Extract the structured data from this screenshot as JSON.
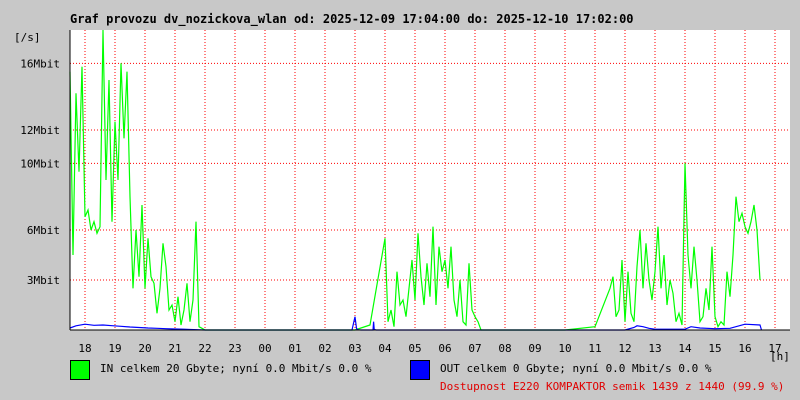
{
  "title": "Graf provozu dv_nozickova_wlan od: 2025-12-09 17:04:00 do: 2025-12-10 17:02:00",
  "colors": {
    "in": "#00ff00",
    "out": "#0000ff",
    "grid": "#ff0000",
    "availability": "#e00000"
  },
  "legend": {
    "in": "IN celkem 20 Gbyte; nyní   0.0 Mbit/s 0.0 %",
    "out": "OUT celkem 0 Gbyte; nyní   0.0 Mbit/s 0.0 %"
  },
  "availability": "Dostupnost E220 KOMPAKTOR semik 1439 z 1440 (99.9 %)",
  "chart_data": {
    "type": "line",
    "y_unit": "[/s]",
    "x_unit": "[h]",
    "x_ticks": [
      "18",
      "19",
      "20",
      "21",
      "22",
      "23",
      "00",
      "01",
      "02",
      "03",
      "04",
      "05",
      "06",
      "07",
      "08",
      "09",
      "10",
      "11",
      "12",
      "13",
      "14",
      "15",
      "16",
      "17"
    ],
    "y_ticks": [
      {
        "label": "3Mbit",
        "value": 3
      },
      {
        "label": "6Mbit",
        "value": 6
      },
      {
        "label": "10Mbit",
        "value": 10
      },
      {
        "label": "12Mbit",
        "value": 12
      },
      {
        "label": "16Mbit",
        "value": 16
      }
    ],
    "y_range": [
      0,
      18
    ],
    "x_range": [
      17.5,
      41.5
    ],
    "grid": true,
    "series": [
      {
        "name": "IN",
        "x": [
          17.5,
          17.6,
          17.7,
          17.8,
          17.9,
          18.0,
          18.1,
          18.2,
          18.3,
          18.4,
          18.5,
          18.6,
          18.7,
          18.8,
          18.9,
          19.0,
          19.1,
          19.2,
          19.3,
          19.4,
          19.5,
          19.6,
          19.7,
          19.8,
          19.9,
          20.0,
          20.1,
          20.2,
          20.3,
          20.4,
          20.5,
          20.6,
          20.7,
          20.8,
          20.9,
          21.0,
          21.1,
          21.2,
          21.3,
          21.4,
          21.5,
          21.6,
          21.7,
          21.8,
          21.9,
          22.0,
          22.1,
          22.2,
          22.3,
          22.4,
          22.5,
          22.6,
          22.7,
          22.8,
          22.9,
          23.0,
          27.0,
          27.5,
          28.0,
          28.1,
          28.2,
          28.3,
          28.4,
          28.5,
          28.6,
          28.7,
          28.8,
          28.9,
          29.0,
          29.1,
          29.2,
          29.3,
          29.4,
          29.5,
          29.6,
          29.7,
          29.8,
          29.9,
          30.0,
          30.1,
          30.2,
          30.3,
          30.4,
          30.5,
          30.6,
          30.7,
          30.8,
          30.9,
          31.0,
          31.1,
          31.2,
          31.3,
          31.5,
          32.0,
          33.0,
          34.0,
          35.0,
          35.5,
          35.6,
          35.7,
          35.8,
          35.9,
          36.0,
          36.1,
          36.2,
          36.3,
          36.4,
          36.5,
          36.6,
          36.7,
          36.8,
          36.9,
          37.0,
          37.1,
          37.2,
          37.3,
          37.4,
          37.5,
          37.6,
          37.7,
          37.8,
          37.9,
          38.0,
          38.1,
          38.2,
          38.3,
          38.4,
          38.5,
          38.6,
          38.7,
          38.8,
          38.9,
          39.0,
          39.1,
          39.2,
          39.3,
          39.4,
          39.5,
          39.6,
          39.7,
          39.8,
          39.9,
          40.0,
          40.1,
          40.2,
          40.3,
          40.4,
          40.5
        ],
        "values": [
          15.5,
          4.5,
          14.2,
          9.5,
          15.8,
          6.8,
          7.2,
          6.0,
          6.5,
          5.8,
          6.2,
          18.0,
          9.0,
          15.0,
          6.5,
          12.5,
          9.0,
          16.0,
          11.5,
          15.5,
          8.0,
          2.5,
          6.0,
          3.2,
          7.5,
          2.5,
          5.5,
          3.2,
          2.8,
          1.0,
          2.5,
          5.2,
          3.8,
          1.2,
          1.5,
          0.5,
          2.0,
          0.3,
          1.2,
          2.8,
          0.5,
          1.8,
          6.5,
          0.2,
          0.1,
          0.0,
          0.0,
          0.0,
          0.0,
          0.0,
          0.0,
          0.0,
          0.0,
          0.0,
          0.0,
          0.0,
          0.0,
          0.3,
          5.5,
          0.5,
          1.2,
          0.2,
          3.5,
          1.5,
          1.8,
          0.8,
          2.5,
          4.2,
          1.8,
          5.8,
          3.2,
          1.5,
          4.0,
          2.0,
          6.2,
          1.5,
          5.0,
          3.5,
          4.2,
          2.5,
          5.0,
          1.8,
          0.8,
          3.0,
          0.5,
          0.3,
          4.0,
          1.2,
          0.8,
          0.5,
          0.0,
          0.0,
          0.0,
          0.0,
          0.0,
          0.0,
          0.2,
          2.5,
          3.2,
          0.8,
          1.2,
          4.2,
          0.5,
          3.5,
          1.0,
          0.5,
          3.8,
          6.0,
          2.5,
          5.2,
          3.0,
          1.8,
          3.5,
          6.2,
          2.5,
          4.5,
          1.5,
          3.0,
          2.2,
          0.5,
          1.0,
          0.3,
          10.0,
          4.5,
          2.5,
          5.0,
          3.0,
          0.5,
          0.8,
          2.5,
          1.2,
          5.0,
          0.8,
          0.2,
          0.5,
          0.3,
          3.5,
          2.0,
          4.5,
          8.0,
          6.5,
          7.0,
          6.2,
          5.8,
          6.5,
          7.5,
          6.0,
          3.0
        ]
      },
      {
        "name": "OUT",
        "x": [
          17.5,
          17.7,
          18.0,
          18.3,
          18.6,
          18.9,
          19.2,
          19.5,
          19.8,
          20.1,
          20.4,
          20.7,
          21.0,
          21.3,
          21.5,
          22.0,
          26.9,
          27.0,
          27.05,
          27.1,
          27.2,
          27.6,
          27.62,
          27.64,
          27.7,
          28.0,
          36.0,
          36.3,
          36.4,
          36.6,
          36.8,
          37.0,
          38.0,
          38.2,
          38.5,
          39.0,
          39.5,
          40.0,
          40.5,
          40.55
        ],
        "values": [
          0.12,
          0.25,
          0.35,
          0.28,
          0.3,
          0.26,
          0.22,
          0.18,
          0.15,
          0.12,
          0.1,
          0.08,
          0.06,
          0.05,
          0.03,
          0.0,
          0.0,
          0.8,
          0.1,
          0.02,
          0.0,
          0.0,
          0.5,
          0.05,
          0.0,
          0.0,
          0.0,
          0.15,
          0.25,
          0.2,
          0.1,
          0.05,
          0.05,
          0.2,
          0.12,
          0.08,
          0.1,
          0.35,
          0.3,
          0.0
        ]
      }
    ]
  }
}
